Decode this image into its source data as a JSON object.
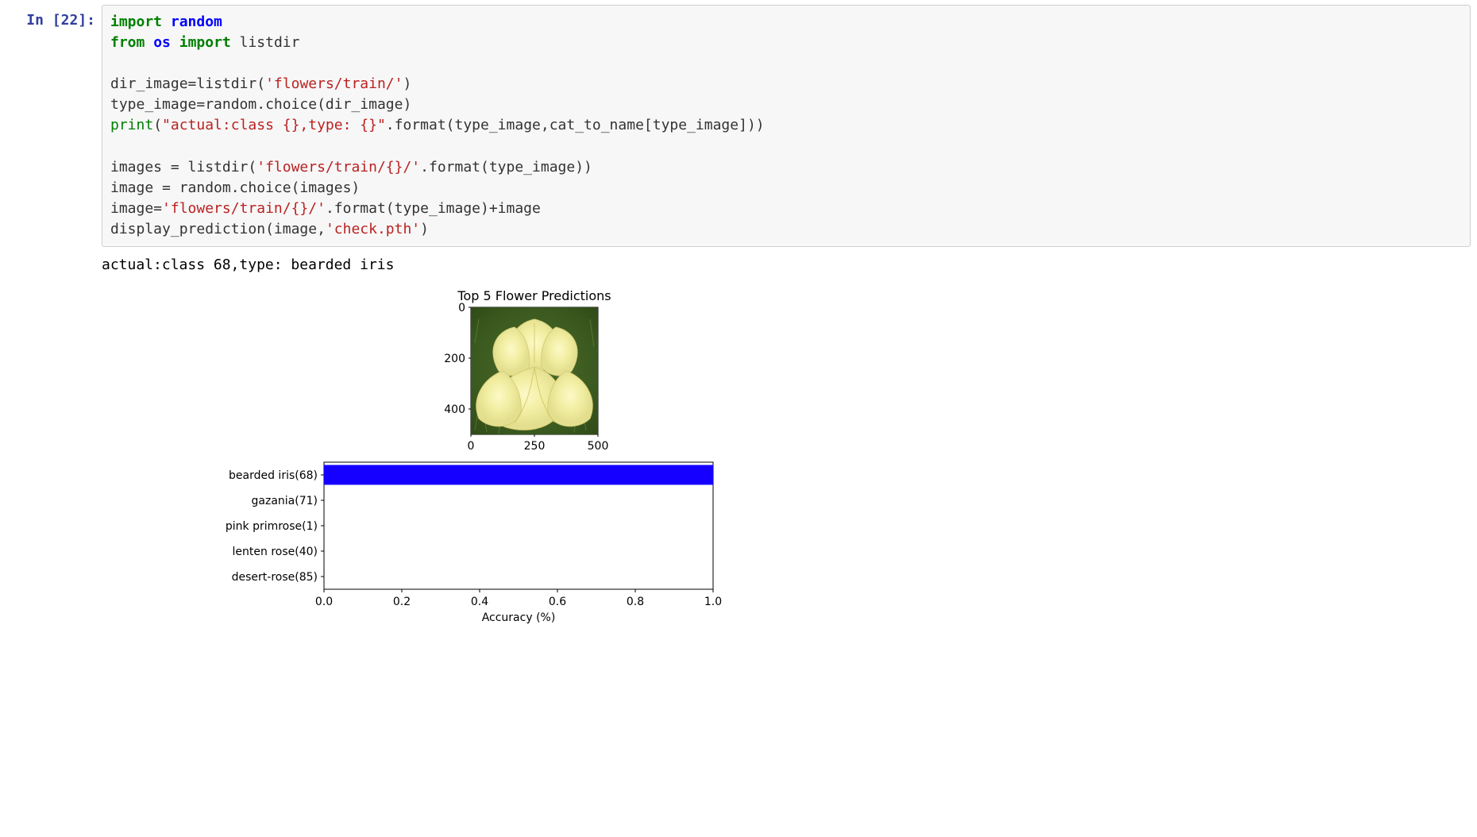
{
  "cell": {
    "prompt": "In [22]:"
  },
  "code": {
    "l1_kw1": "import",
    "l1_mod": "random",
    "l2_kw1": "from",
    "l2_mod": "os",
    "l2_kw2": "import",
    "l2_name": "listdir",
    "l3_a": "dir_image",
    "l3_op": "=",
    "l3_b": "listdir(",
    "l3_str": "'flowers/train/'",
    "l3_end": ")",
    "l4": "type_image=random.choice(dir_image)",
    "l5_builtin": "print",
    "l5_open": "(",
    "l5_str": "\"actual:class {},type: {}\"",
    "l5_rest": ".format(type_image,cat_to_name[type_image]))",
    "l6_a": "images = listdir(",
    "l6_str": "'flowers/train/{}/'",
    "l6_rest": ".format(type_image))",
    "l7": "image = random.choice(images)",
    "l8_a": "image=",
    "l8_str": "'flowers/train/{}/'",
    "l8_rest": ".format(type_image)+image",
    "l9_a": "display_prediction(image,",
    "l9_str": "'check.pth'",
    "l9_end": ")"
  },
  "output_text": "actual:class 68,type: bearded iris",
  "figure": {
    "title": "Top 5 Flower Predictions",
    "image_yticks": [
      "0",
      "200",
      "400"
    ],
    "image_xticks": [
      "0",
      "250",
      "500"
    ],
    "bar_xlabel": "Accuracy (%)",
    "bar_xticks": [
      "0.0",
      "0.2",
      "0.4",
      "0.6",
      "0.8",
      "1.0"
    ],
    "bar_ylabels": [
      "bearded iris(68)",
      "gazania(71)",
      "pink primrose(1)",
      "lenten rose(40)",
      "desert-rose(85)"
    ]
  },
  "chart_data": {
    "type": "bar",
    "orientation": "horizontal",
    "title": "Top 5 Flower Predictions",
    "xlabel": "Accuracy (%)",
    "ylabel": "",
    "xlim": [
      0.0,
      1.0
    ],
    "categories": [
      "bearded iris(68)",
      "gazania(71)",
      "pink primrose(1)",
      "lenten rose(40)",
      "desert-rose(85)"
    ],
    "values": [
      1.0,
      0.0,
      0.0,
      0.0,
      0.0
    ]
  }
}
